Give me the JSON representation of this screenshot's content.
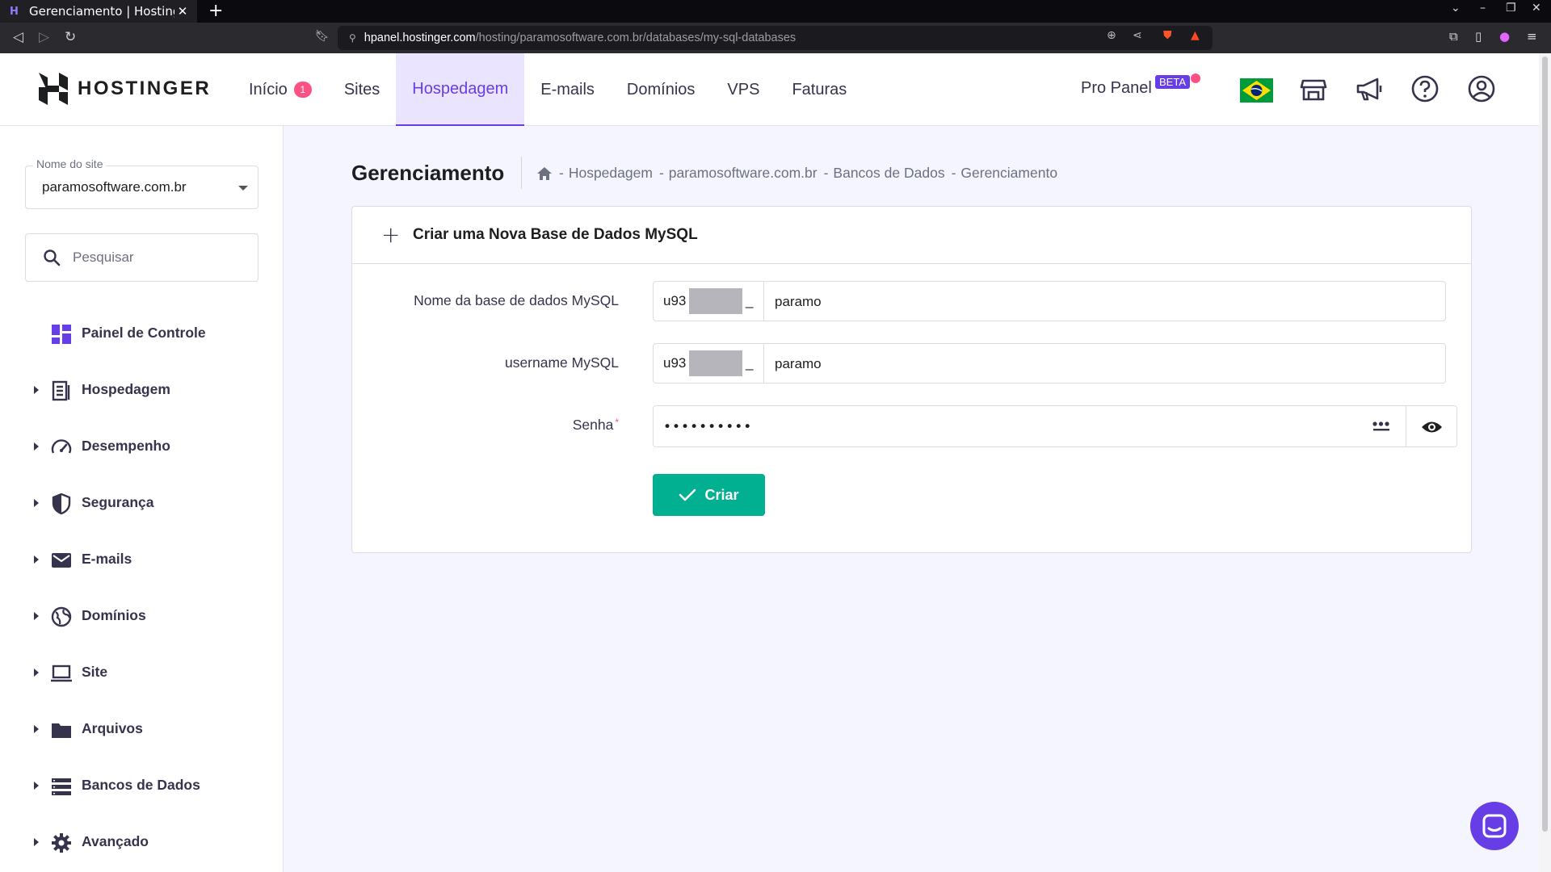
{
  "browser": {
    "tab_title": "Gerenciamento | Hostinger",
    "url_host": "hpanel.hostinger.com",
    "url_path": "/hosting/paramosoftware.com.br/databases/my-sql-databases"
  },
  "header": {
    "brand": "HOSTINGER",
    "nav": [
      {
        "label": "Início",
        "badge": "1"
      },
      {
        "label": "Sites"
      },
      {
        "label": "Hospedagem",
        "active": true
      },
      {
        "label": "E-mails"
      },
      {
        "label": "Domínios"
      },
      {
        "label": "VPS"
      },
      {
        "label": "Faturas"
      }
    ],
    "pro_panel": "Pro Panel",
    "beta": "BETA",
    "icons": [
      "brazil-flag",
      "store-icon",
      "megaphone-icon",
      "help-icon",
      "account-icon"
    ]
  },
  "sidebar": {
    "site_label": "Nome do site",
    "site_value": "paramosoftware.com.br",
    "search_placeholder": "Pesquisar",
    "items": [
      {
        "label": "Painel de Controle",
        "icon": "dashboard-icon"
      },
      {
        "label": "Hospedagem",
        "icon": "hosting-icon"
      },
      {
        "label": "Desempenho",
        "icon": "gauge-icon"
      },
      {
        "label": "Segurança",
        "icon": "shield-icon"
      },
      {
        "label": "E-mails",
        "icon": "mail-icon"
      },
      {
        "label": "Domínios",
        "icon": "globe-icon"
      },
      {
        "label": "Site",
        "icon": "laptop-icon"
      },
      {
        "label": "Arquivos",
        "icon": "folder-icon"
      },
      {
        "label": "Bancos de Dados",
        "icon": "database-icon"
      },
      {
        "label": "Avançado",
        "icon": "gear-icon"
      }
    ]
  },
  "main": {
    "title": "Gerenciamento",
    "breadcrumb": [
      "Hospedagem",
      "paramosoftware.com.br",
      "Bancos de Dados",
      "Gerenciamento"
    ],
    "breadcrumb_sep": "-",
    "card": {
      "title": "Criar uma Nova Base de Dados MySQL",
      "db_label": "Nome da base de dados MySQL",
      "db_prefix_start": "u93",
      "db_prefix_end": "_",
      "db_value": "paramo",
      "user_label": "username MySQL",
      "user_prefix_start": "u93",
      "user_prefix_end": "_",
      "user_value": "paramo",
      "password_label": "Senha",
      "password_required": "*",
      "password_value": "••••••••••",
      "create_button": "Criar"
    }
  },
  "colors": {
    "accent": "#673de6",
    "success": "#00b090",
    "badge": "#fc5185"
  }
}
